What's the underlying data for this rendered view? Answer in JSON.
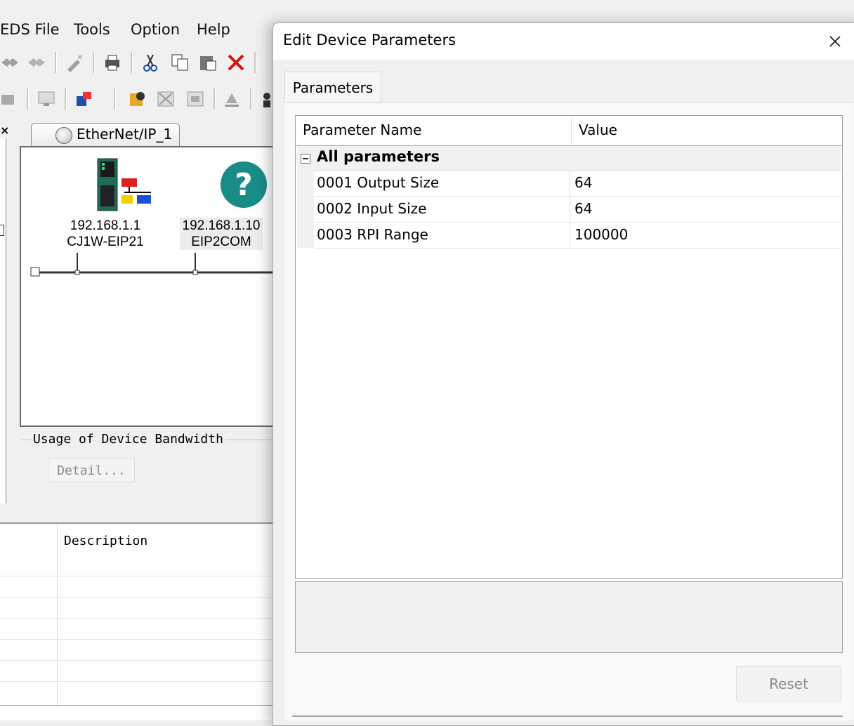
{
  "app": {
    "menu": [
      "EDS File",
      "Tools",
      "Option",
      "Help"
    ],
    "network_tab": "EtherNet/IP_1",
    "devices": [
      {
        "ip": "192.168.1.1",
        "model": "CJ1W-EIP21"
      },
      {
        "ip": "192.168.1.10",
        "model": "EIP2COM"
      }
    ],
    "bandwidth_group_label": "Usage of Device Bandwidth",
    "detail_button": "Detail...",
    "lower_panel_header": "Description"
  },
  "dialog": {
    "title": "Edit Device Parameters",
    "tab": "Parameters",
    "grid": {
      "columns": [
        "Parameter Name",
        "Value"
      ],
      "group": "All parameters",
      "rows": [
        {
          "name": "0001 Output Size",
          "value": "64"
        },
        {
          "name": "0002 Input Size",
          "value": "64"
        },
        {
          "name": "0003 RPI Range",
          "value": "100000"
        }
      ]
    },
    "reset_button": "Reset"
  },
  "colors": {
    "accent_teal": "#1a8c87",
    "device_green": "#1f6b5a",
    "network_red": "#e02020",
    "network_blue": "#1c4fd6",
    "network_yellow": "#f0d000"
  },
  "icons": {
    "close": "close-icon",
    "question": "question-icon",
    "globe": "globe-icon",
    "expander": "collapse-icon"
  }
}
